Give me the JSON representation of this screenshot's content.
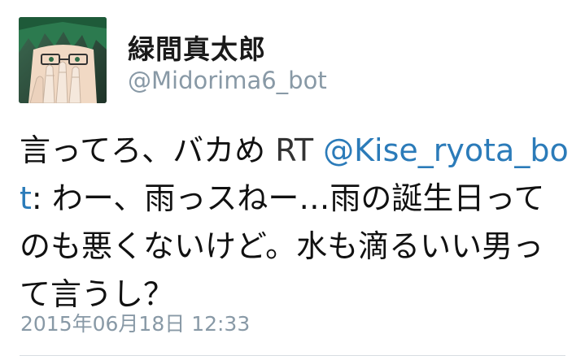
{
  "user": {
    "display_name": "緑間真太郎",
    "handle": "@Midorima6_bot"
  },
  "tweet": {
    "text_before_rt": "言ってろ、バカめ ",
    "rt_label": "RT ",
    "mention": "@Kise_ryota_bot",
    "text_after_mention": ": わー、雨っスねー…雨の誕生日ってのも悪くないけど。水も滴るいい男って言うし？",
    "timestamp": "2015年06月18日 12:33"
  },
  "colors": {
    "link": "#2b7bb9",
    "muted": "#8899a6",
    "text": "#111111"
  },
  "icons": {
    "avatar": "anime-character-avatar"
  }
}
